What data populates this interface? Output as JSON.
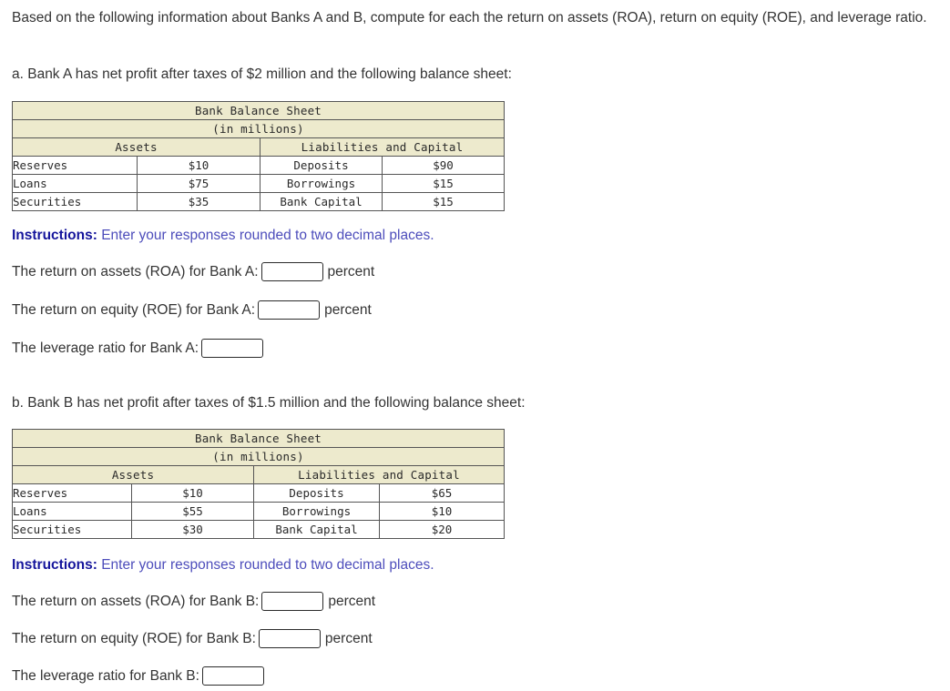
{
  "intro": {
    "text": "Based on the following information about Banks A and B, compute for each the return on assets (ROA), return on equity (ROE), and leverage ratio."
  },
  "parts": [
    {
      "id": "a",
      "prompt": "a. Bank A has net profit after taxes of $2 million and the following balance sheet:",
      "balance_sheet": {
        "title": "Bank Balance Sheet",
        "subtitle": "(in millions)",
        "assets_header": "Assets",
        "liabilities_header": "Liabilities and Capital",
        "rows": [
          {
            "asset_label": "Reserves",
            "asset_value": "$10",
            "liability_label": "Deposits",
            "liability_value": "$90"
          },
          {
            "asset_label": "Loans",
            "asset_value": "$75",
            "liability_label": "Borrowings",
            "liability_value": "$15"
          },
          {
            "asset_label": "Securities",
            "asset_value": "$35",
            "liability_label": "Bank Capital",
            "liability_value": "$15"
          }
        ]
      },
      "instructions": {
        "lead": "Instructions:",
        "body": "Enter your responses rounded to two decimal places."
      },
      "answers": [
        {
          "label": "The return on assets (ROA) for Bank A:",
          "value": "",
          "placeholder": "",
          "suffix": "percent"
        },
        {
          "label": "The return on equity (ROE) for Bank A:",
          "value": "",
          "placeholder": "",
          "suffix": "percent"
        },
        {
          "label": "The leverage ratio for Bank A:",
          "value": "",
          "placeholder": "",
          "suffix": ""
        }
      ]
    },
    {
      "id": "b",
      "prompt": "b. Bank B has net profit after taxes of $1.5 million and the following balance sheet:",
      "balance_sheet": {
        "title": "Bank Balance Sheet",
        "subtitle": "(in millions)",
        "assets_header": "Assets",
        "liabilities_header": "Liabilities and Capital",
        "rows": [
          {
            "asset_label": "Reserves",
            "asset_value": "$10",
            "liability_label": "Deposits",
            "liability_value": "$65"
          },
          {
            "asset_label": "Loans",
            "asset_value": "$55",
            "liability_label": "Borrowings",
            "liability_value": "$10"
          },
          {
            "asset_label": "Securities",
            "asset_value": "$30",
            "liability_label": "Bank Capital",
            "liability_value": "$20"
          }
        ]
      },
      "instructions": {
        "lead": "Instructions:",
        "body": "Enter your responses rounded to two decimal places."
      },
      "answers": [
        {
          "label": "The return on assets (ROA) for Bank B:",
          "value": "",
          "placeholder": "",
          "suffix": "percent"
        },
        {
          "label": "The return on equity (ROE) for Bank B:",
          "value": "",
          "placeholder": "",
          "suffix": "percent"
        },
        {
          "label": "The leverage ratio for Bank B:",
          "value": "",
          "placeholder": "",
          "suffix": ""
        }
      ]
    }
  ],
  "colors": {
    "table_header_bg": "#edeacd",
    "table_border": "#555555",
    "instructions_lead": "#16169c",
    "instructions_body": "#4d4dbb",
    "body_text": "#333333"
  }
}
